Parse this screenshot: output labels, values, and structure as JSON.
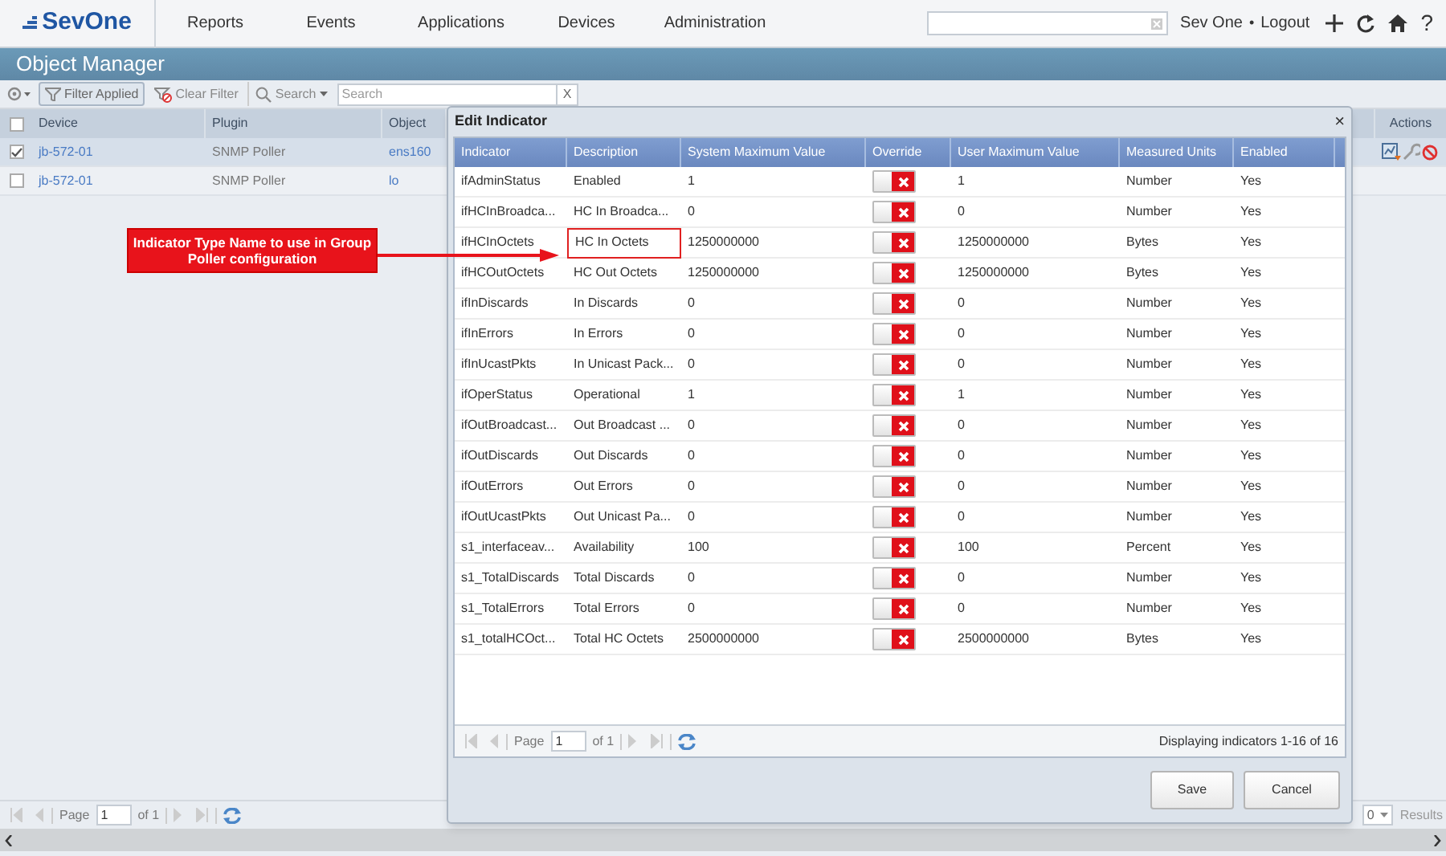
{
  "nav": {
    "logo": "SevOne",
    "menu": [
      "Reports",
      "Events",
      "Applications",
      "Devices",
      "Administration"
    ],
    "user": "Sev One",
    "separator": "•",
    "logout": "Logout",
    "help": "?"
  },
  "title": "Object Manager",
  "toolbar": {
    "filter_applied": "Filter Applied",
    "clear_filter": "Clear Filter",
    "search_menu": "Search",
    "search_placeholder": "Search",
    "clear": "X"
  },
  "grid": {
    "all_checked": false,
    "columns": [
      "Device",
      "Plugin",
      "Object"
    ],
    "actions_column": "Actions",
    "rows": [
      {
        "device": "jb-572-01",
        "plugin": "SNMP Poller",
        "object": "ens160",
        "checked": true,
        "selected": true
      },
      {
        "device": "jb-572-01",
        "plugin": "SNMP Poller",
        "object": "lo",
        "checked": false,
        "selected": false
      }
    ]
  },
  "pager": {
    "page_label": "Page",
    "page": "1",
    "of": "of 1",
    "page_size": "0",
    "results": "Results"
  },
  "dialog": {
    "title": "Edit Indicator",
    "close": "×",
    "columns": [
      "Indicator",
      "Description",
      "System Maximum Value",
      "Override",
      "User Maximum Value",
      "Measured Units",
      "Enabled"
    ],
    "rows": [
      {
        "indicator": "ifAdminStatus",
        "description": "Enabled",
        "system_max": "1",
        "override": false,
        "user_max": "1",
        "units": "Number",
        "enabled": "Yes",
        "highlighted": false
      },
      {
        "indicator": "ifHCInBroadca...",
        "description": "HC In Broadca...",
        "system_max": "0",
        "override": false,
        "user_max": "0",
        "units": "Number",
        "enabled": "Yes",
        "highlighted": false
      },
      {
        "indicator": "ifHCInOctets",
        "description": "HC In Octets",
        "system_max": "1250000000",
        "override": false,
        "user_max": "1250000000",
        "units": "Bytes",
        "enabled": "Yes",
        "highlighted": true
      },
      {
        "indicator": "ifHCOutOctets",
        "description": "HC Out Octets",
        "system_max": "1250000000",
        "override": false,
        "user_max": "1250000000",
        "units": "Bytes",
        "enabled": "Yes",
        "highlighted": false
      },
      {
        "indicator": "ifInDiscards",
        "description": "In Discards",
        "system_max": "0",
        "override": false,
        "user_max": "0",
        "units": "Number",
        "enabled": "Yes",
        "highlighted": false
      },
      {
        "indicator": "ifInErrors",
        "description": "In Errors",
        "system_max": "0",
        "override": false,
        "user_max": "0",
        "units": "Number",
        "enabled": "Yes",
        "highlighted": false
      },
      {
        "indicator": "ifInUcastPkts",
        "description": "In Unicast Pack...",
        "system_max": "0",
        "override": false,
        "user_max": "0",
        "units": "Number",
        "enabled": "Yes",
        "highlighted": false
      },
      {
        "indicator": "ifOperStatus",
        "description": "Operational",
        "system_max": "1",
        "override": false,
        "user_max": "1",
        "units": "Number",
        "enabled": "Yes",
        "highlighted": false
      },
      {
        "indicator": "ifOutBroadcast...",
        "description": "Out Broadcast ...",
        "system_max": "0",
        "override": false,
        "user_max": "0",
        "units": "Number",
        "enabled": "Yes",
        "highlighted": false
      },
      {
        "indicator": "ifOutDiscards",
        "description": "Out Discards",
        "system_max": "0",
        "override": false,
        "user_max": "0",
        "units": "Number",
        "enabled": "Yes",
        "highlighted": false
      },
      {
        "indicator": "ifOutErrors",
        "description": "Out Errors",
        "system_max": "0",
        "override": false,
        "user_max": "0",
        "units": "Number",
        "enabled": "Yes",
        "highlighted": false
      },
      {
        "indicator": "ifOutUcastPkts",
        "description": "Out Unicast Pa...",
        "system_max": "0",
        "override": false,
        "user_max": "0",
        "units": "Number",
        "enabled": "Yes",
        "highlighted": false
      },
      {
        "indicator": "s1_interfaceav...",
        "description": "Availability",
        "system_max": "100",
        "override": false,
        "user_max": "100",
        "units": "Percent",
        "enabled": "Yes",
        "highlighted": false
      },
      {
        "indicator": "s1_TotalDiscards",
        "description": "Total Discards",
        "system_max": "0",
        "override": false,
        "user_max": "0",
        "units": "Number",
        "enabled": "Yes",
        "highlighted": false
      },
      {
        "indicator": "s1_TotalErrors",
        "description": "Total Errors",
        "system_max": "0",
        "override": false,
        "user_max": "0",
        "units": "Number",
        "enabled": "Yes",
        "highlighted": false
      },
      {
        "indicator": "s1_totalHCOct...",
        "description": "Total HC Octets",
        "system_max": "2500000000",
        "override": false,
        "user_max": "2500000000",
        "units": "Bytes",
        "enabled": "Yes",
        "highlighted": false
      }
    ],
    "pager": {
      "page_label": "Page",
      "page": "1",
      "of": "of 1",
      "display": "Displaying indicators 1-16 of 16"
    },
    "buttons": [
      "Save",
      "Cancel"
    ]
  },
  "callout": "Indicator Type Name to use in Group Poller configuration"
}
